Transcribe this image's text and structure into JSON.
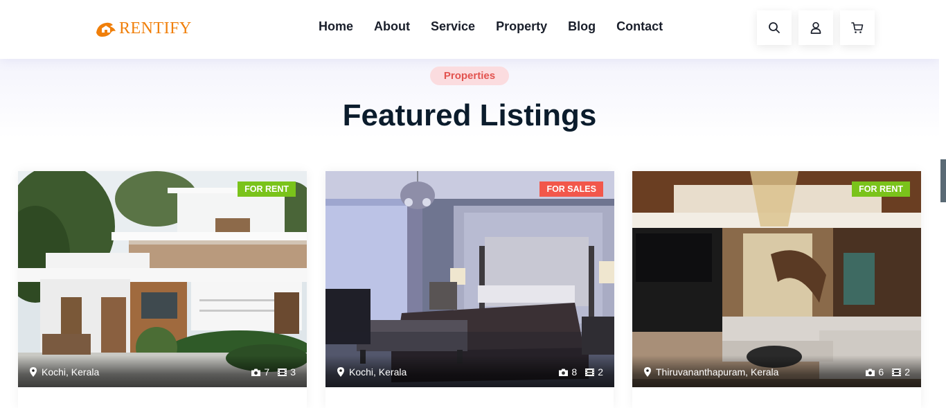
{
  "brand": {
    "name": "RENTIFY",
    "color": "#f07f0a"
  },
  "nav": {
    "items": [
      "Home",
      "About",
      "Service",
      "Property",
      "Blog",
      "Contact"
    ]
  },
  "header_icons": [
    "search-icon",
    "user-icon",
    "cart-icon"
  ],
  "section": {
    "tag": "Properties",
    "title": "Featured Listings"
  },
  "colors": {
    "rent_badge": "#7ac31b",
    "sale_badge": "#f2574b",
    "tag_bg": "#fbdcdf",
    "tag_text": "#e2534f"
  },
  "listings": [
    {
      "badge": "FOR RENT",
      "location": "Kochi, Kerala",
      "photos": "7",
      "videos": "3",
      "image": "modern-house-exterior"
    },
    {
      "badge": "FOR SALES",
      "location": "Kochi, Kerala",
      "photos": "8",
      "videos": "2",
      "image": "bedroom-interior"
    },
    {
      "badge": "FOR RENT",
      "location": "Thiruvananthapuram, Kerala",
      "photos": "6",
      "videos": "2",
      "image": "living-room-interior"
    }
  ]
}
